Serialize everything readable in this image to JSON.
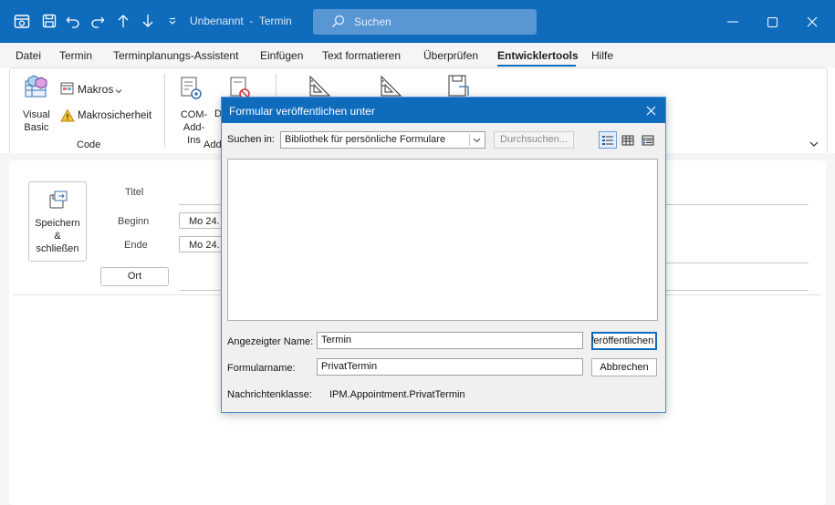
{
  "titlebar": {
    "title": "Unbenannt  -  Termin",
    "search_placeholder": "Suchen",
    "accent": "#0f6cbd"
  },
  "menu": {
    "items": [
      "Datei",
      "Termin",
      "Terminplanungs-Assistent",
      "Einfügen",
      "Text formatieren",
      "Überprüfen",
      "Entwicklertools",
      "Hilfe"
    ],
    "active": "Entwicklertools"
  },
  "ribbon": {
    "visual_basic": "Visual\nBasic",
    "macros": "Makros",
    "macro_security": "Makrosicherheit",
    "group_code": "Code",
    "com_addins": "COM-\nAdd-Ins",
    "group_addins": "Add",
    "partial_d": "D"
  },
  "form": {
    "save_close": "Speichern\n&\nschließen",
    "title_label": "Titel",
    "start_label": "Beginn",
    "end_label": "Ende",
    "start_value": "Mo 24.",
    "end_value": "Mo 24.",
    "location_button": "Ort"
  },
  "dialog": {
    "title": "Formular veröffentlichen unter",
    "look_in_label": "Suchen in:",
    "look_in_value": "Bibliothek für persönliche Formulare",
    "browse_button": "Durchsuchen...",
    "display_name_label": "Angezeigter Name:",
    "display_name_value": "Termin",
    "form_name_label": "Formularname:",
    "form_name_value": "PrivatTermin",
    "publish_button": "Veröffentlichen",
    "cancel_button": "Abbrechen",
    "message_class_label": "Nachrichtenklasse:",
    "message_class_value": "IPM.Appointment.PrivatTermin"
  }
}
